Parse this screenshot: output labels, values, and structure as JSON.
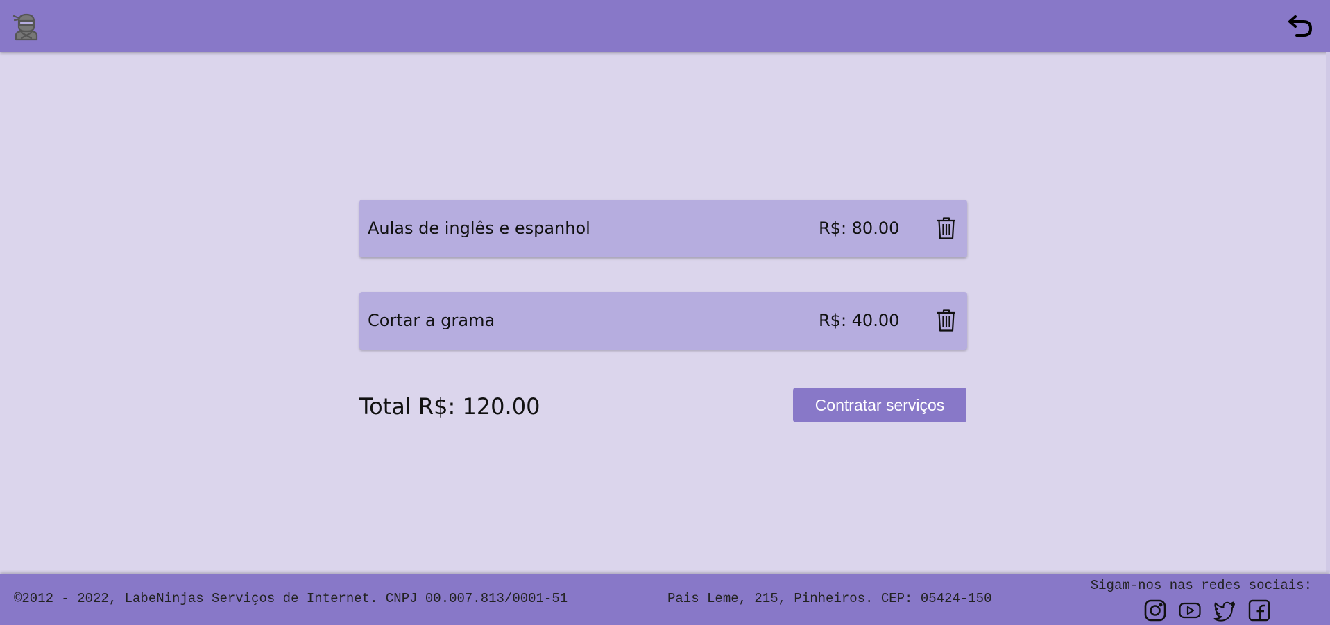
{
  "header": {
    "logo_icon": "ninja-icon",
    "back_icon": "undo-arrow-icon"
  },
  "cart": {
    "items": [
      {
        "name": "Aulas de inglês e espanhol",
        "price": "R$: 80.00",
        "remove_icon": "trash-icon"
      },
      {
        "name": "Cortar a grama",
        "price": "R$: 40.00",
        "remove_icon": "trash-icon"
      }
    ],
    "total": "Total R$: 120.00",
    "hire_button": "Contratar serviços"
  },
  "footer": {
    "copyright": "©2012 - 2022, LabeNinjas Serviços de Internet. CNPJ 00.007.813/0001-51",
    "address": "Pais Leme, 215, Pinheiros. CEP: 05424-150",
    "social_title": "Sigam-nos nas redes sociais:",
    "social_icons": [
      "instagram-icon",
      "youtube-icon",
      "twitter-icon",
      "facebook-icon"
    ]
  },
  "colors": {
    "header_bg": "#8878c8",
    "page_bg": "#dbd5ec",
    "card_bg": "#b6addf",
    "button_bg": "#8878c8"
  }
}
